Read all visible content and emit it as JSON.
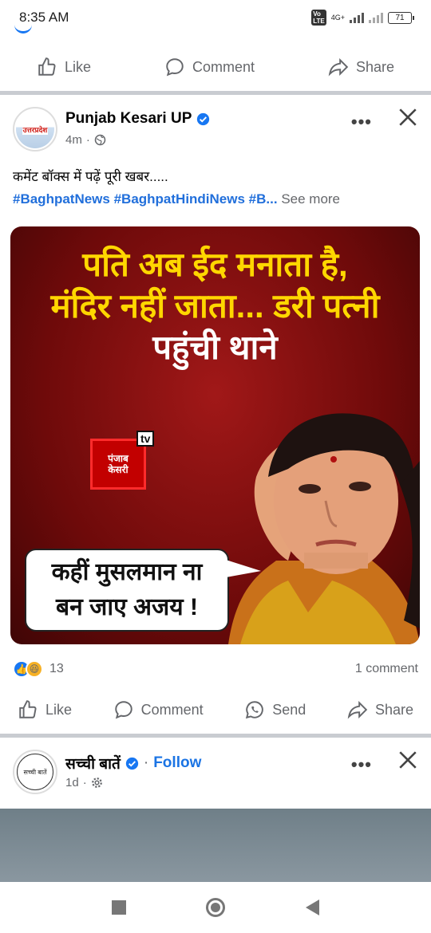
{
  "status_bar": {
    "time": "8:35 AM",
    "network": "4G+",
    "battery": "71"
  },
  "top_actions": {
    "like": "Like",
    "comment": "Comment",
    "share": "Share"
  },
  "post1": {
    "page_name": "Punjab Kesari UP",
    "avatar_text": "उत्तरप्रदेश",
    "time": "4m",
    "caption": "कमेंट बॉक्स में पढ़ें पूरी खबर.....",
    "hashtags": "#BaghpatNews #BaghpatHindiNews #B...",
    "see_more": "See more",
    "image": {
      "headline_line1": "पति अब ईद मनाता है,",
      "headline_line2": "मंदिर नहीं जाता... डरी पत्नी",
      "headline_line3": "पहुंची थाने",
      "logo_line1": "पंजाब",
      "logo_line2": "केसरी",
      "logo_tv": "tv",
      "bubble_line1": "कहीं मुसलमान ना",
      "bubble_line2": "बन जाए अजय !"
    },
    "reaction_count": "13",
    "comment_count": "1 comment",
    "actions": {
      "like": "Like",
      "comment": "Comment",
      "send": "Send",
      "share": "Share"
    }
  },
  "post2": {
    "page_name": "सच्ची बातें",
    "avatar_text": "सच्ची बातें",
    "follow": "Follow",
    "time": "1d"
  },
  "colors": {
    "accent": "#1b74e4",
    "hashtag": "#216fdb",
    "headline_yellow": "#ffd700",
    "image_red": "#8a0f0f"
  }
}
